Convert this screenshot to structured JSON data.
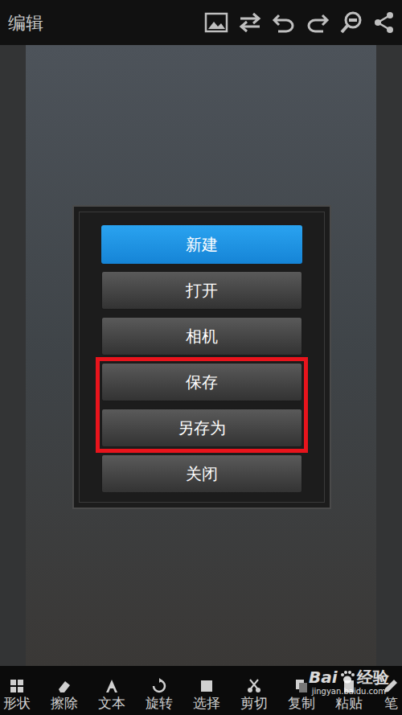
{
  "topbar": {
    "title": "编辑"
  },
  "dialog": {
    "buttons": [
      {
        "label": "新建",
        "selected": true,
        "highlighted": false
      },
      {
        "label": "打开",
        "selected": false,
        "highlighted": false
      },
      {
        "label": "相机",
        "selected": false,
        "highlighted": false
      },
      {
        "label": "保存",
        "selected": false,
        "highlighted": true
      },
      {
        "label": "另存为",
        "selected": false,
        "highlighted": true
      },
      {
        "label": "关闭",
        "selected": false,
        "highlighted": false
      }
    ]
  },
  "toolbar": {
    "items": [
      {
        "label": "形状"
      },
      {
        "label": "擦除"
      },
      {
        "label": "文本"
      },
      {
        "label": "旋转"
      },
      {
        "label": "选择"
      },
      {
        "label": "剪切"
      },
      {
        "label": "复制"
      },
      {
        "label": "粘贴"
      },
      {
        "label": "笔"
      }
    ]
  },
  "watermark": {
    "logo": "Bai",
    "brand": "经验",
    "url": "jingyan.baidu.com"
  }
}
